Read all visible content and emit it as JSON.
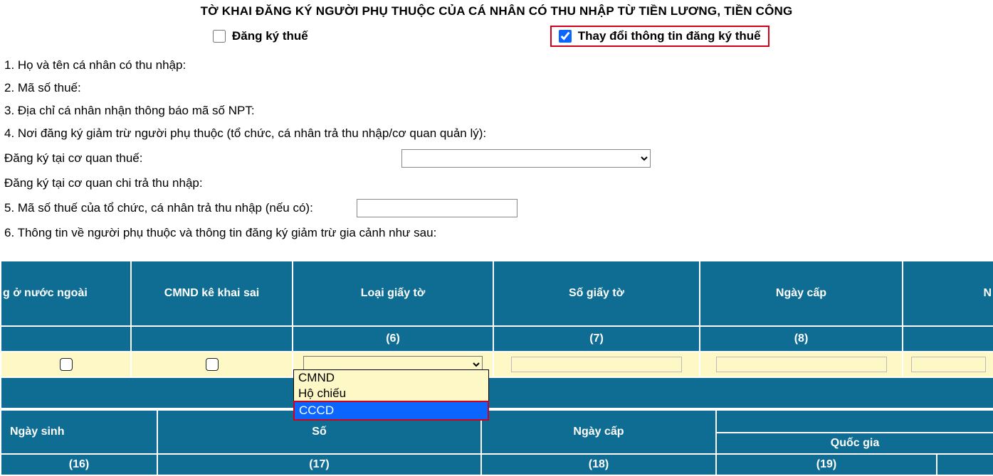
{
  "title": "TỜ KHAI ĐĂNG KÝ NGƯỜI PHỤ THUỘC CỦA CÁ NHÂN CÓ THU NHẬP TỪ TIỀN LƯƠNG, TIỀN CÔNG",
  "checkboxes": {
    "register_label": "Đăng ký thuế",
    "change_label": "Thay đổi thông tin đăng ký thuế"
  },
  "fields": {
    "f1": "1. Họ và tên cá nhân có thu nhập:",
    "f2": "2. Mã số thuế:",
    "f3": "3. Địa chỉ cá nhân nhận thông báo mã số NPT:",
    "f4": "4. Nơi đăng ký giảm trừ người phụ thuộc (tổ chức, cá nhân trả thu nhập/cơ quan quản lý):",
    "f_agency": "Đăng ký tại cơ quan thuế:",
    "f_payer": "Đăng ký tại cơ quan chi trả thu nhập:",
    "f5": "5. Mã số thuế của tổ chức, cá nhân trả thu nhập (nếu có):",
    "f6": "6. Thông tin về người phụ thuộc và thông tin đăng ký giảm trừ gia cảnh như sau:"
  },
  "table1": {
    "headers": {
      "c0": "g ở nước ngoài",
      "c1": "CMND kê khai sai",
      "c2": "Loại giấy tờ",
      "c3": "Số giấy tờ",
      "c4": "Ngày cấp",
      "c5": "N"
    },
    "nums": {
      "n2": "(6)",
      "n3": "(7)",
      "n4": "(8)"
    }
  },
  "dropdown": {
    "opt1": "CMND",
    "opt2": "Hộ chiếu",
    "opt3": "CCCD"
  },
  "table2": {
    "headers": {
      "c0": "Ngày sinh",
      "c1": "Số",
      "c2": "Ngày cấp",
      "c3": "Quốc gia"
    },
    "nums": {
      "n0": "(16)",
      "n1": "(17)",
      "n2": "(18)",
      "n3": "(19)"
    }
  }
}
